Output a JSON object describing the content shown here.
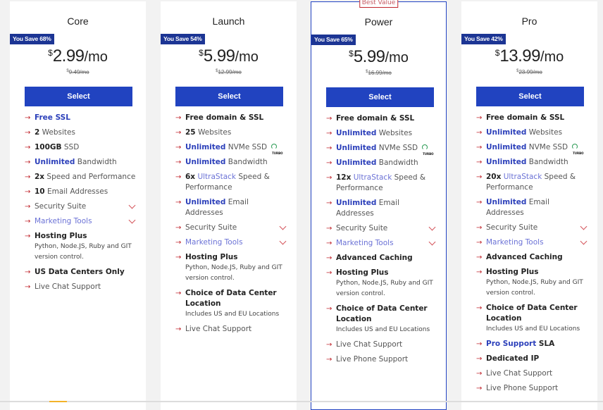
{
  "plans": [
    {
      "name": "Core",
      "save": "You Save 68%",
      "currency": "$",
      "price": "2.99",
      "per": "/mo",
      "old_currency": "$",
      "old_price": "9.49/mo",
      "select": "Select",
      "features": [
        {
          "parts": [
            {
              "t": "Free SSL",
              "s": "blue"
            }
          ]
        },
        {
          "parts": [
            {
              "t": "2",
              "s": "bold"
            },
            {
              "t": " Websites"
            }
          ]
        },
        {
          "parts": [
            {
              "t": "100GB",
              "s": "bold"
            },
            {
              "t": " SSD"
            }
          ]
        },
        {
          "parts": [
            {
              "t": "Unlimited",
              "s": "blue"
            },
            {
              "t": " Bandwidth"
            }
          ]
        },
        {
          "parts": [
            {
              "t": "2x",
              "s": "bold"
            },
            {
              "t": " Speed and Performance"
            }
          ]
        },
        {
          "parts": [
            {
              "t": "10",
              "s": "bold"
            },
            {
              "t": " Email Addresses"
            }
          ]
        },
        {
          "parts": [
            {
              "t": "Security Suite"
            }
          ],
          "toggle": true
        },
        {
          "parts": [
            {
              "t": "Marketing Tools",
              "s": "light-blue"
            }
          ],
          "toggle": true
        },
        {
          "parts": [
            {
              "t": "Hosting Plus",
              "s": "bold"
            }
          ],
          "sub": "Python,  Node.JS,  Ruby and GIT version control."
        },
        {
          "parts": [
            {
              "t": "US Data Centers Only",
              "s": "bold"
            }
          ]
        },
        {
          "parts": [
            {
              "t": "Live Chat Support"
            }
          ]
        }
      ]
    },
    {
      "name": "Launch",
      "save": "You Save 54%",
      "currency": "$",
      "price": "5.99",
      "per": "/mo",
      "old_currency": "$",
      "old_price": "12.99/mo",
      "select": "Select",
      "features": [
        {
          "parts": [
            {
              "t": "Free domain & SSL",
              "s": "bold"
            }
          ]
        },
        {
          "parts": [
            {
              "t": "25",
              "s": "bold"
            },
            {
              "t": " Websites"
            }
          ]
        },
        {
          "parts": [
            {
              "t": "Unlimited",
              "s": "blue"
            },
            {
              "t": " NVMe SSD"
            }
          ],
          "turbo": true
        },
        {
          "parts": [
            {
              "t": "Unlimited",
              "s": "blue"
            },
            {
              "t": " Bandwidth"
            }
          ]
        },
        {
          "parts": [
            {
              "t": "6x",
              "s": "bold"
            },
            {
              "t": " "
            },
            {
              "t": "UltraStack",
              "s": "light-blue"
            },
            {
              "t": " Speed & Performance"
            }
          ]
        },
        {
          "parts": [
            {
              "t": "Unlimited",
              "s": "blue"
            },
            {
              "t": " Email Addresses"
            }
          ]
        },
        {
          "parts": [
            {
              "t": "Security Suite"
            }
          ],
          "toggle": true
        },
        {
          "parts": [
            {
              "t": "Marketing Tools",
              "s": "light-blue"
            }
          ],
          "toggle": true
        },
        {
          "parts": [
            {
              "t": "Hosting Plus",
              "s": "bold"
            }
          ],
          "sub": "Python,  Node.JS,  Ruby and GIT version control."
        },
        {
          "parts": [
            {
              "t": "Choice of Data Center Location",
              "s": "bold"
            }
          ],
          "sub": "Includes US and EU Locations"
        },
        {
          "parts": [
            {
              "t": "Live Chat Support"
            }
          ]
        }
      ]
    },
    {
      "name": "Power",
      "save": "You Save 65%",
      "currency": "$",
      "price": "5.99",
      "per": "/mo",
      "old_currency": "$",
      "old_price": "16.99/mo",
      "select": "Select",
      "tag": "Best Value",
      "features": [
        {
          "parts": [
            {
              "t": "Free domain & SSL",
              "s": "bold"
            }
          ]
        },
        {
          "parts": [
            {
              "t": "Unlimited",
              "s": "blue"
            },
            {
              "t": " Websites"
            }
          ]
        },
        {
          "parts": [
            {
              "t": "Unlimited",
              "s": "blue"
            },
            {
              "t": " NVMe SSD"
            }
          ],
          "turbo": true
        },
        {
          "parts": [
            {
              "t": "Unlimited",
              "s": "blue"
            },
            {
              "t": " Bandwidth"
            }
          ]
        },
        {
          "parts": [
            {
              "t": "12x",
              "s": "bold"
            },
            {
              "t": " "
            },
            {
              "t": "UltraStack",
              "s": "light-blue"
            },
            {
              "t": " Speed & Performance"
            }
          ]
        },
        {
          "parts": [
            {
              "t": "Unlimited",
              "s": "blue"
            },
            {
              "t": " Email Addresses"
            }
          ]
        },
        {
          "parts": [
            {
              "t": "Security Suite"
            }
          ],
          "toggle": true
        },
        {
          "parts": [
            {
              "t": "Marketing Tools",
              "s": "light-blue"
            }
          ],
          "toggle": true
        },
        {
          "parts": [
            {
              "t": "Advanced Caching",
              "s": "bold"
            }
          ]
        },
        {
          "parts": [
            {
              "t": "Hosting Plus",
              "s": "bold"
            }
          ],
          "sub": "Python,  Node.JS,  Ruby and GIT version control."
        },
        {
          "parts": [
            {
              "t": "Choice of Data Center Location",
              "s": "bold"
            }
          ],
          "sub": "Includes US and EU Locations"
        },
        {
          "parts": [
            {
              "t": "Live Chat Support"
            }
          ]
        },
        {
          "parts": [
            {
              "t": "Live Phone Support"
            }
          ]
        }
      ]
    },
    {
      "name": "Pro",
      "save": "You Save 42%",
      "currency": "$",
      "price": "13.99",
      "per": "/mo",
      "old_currency": "$",
      "old_price": "23.99/mo",
      "select": "Select",
      "features": [
        {
          "parts": [
            {
              "t": "Free domain & SSL",
              "s": "bold"
            }
          ]
        },
        {
          "parts": [
            {
              "t": "Unlimited",
              "s": "blue"
            },
            {
              "t": " Websites"
            }
          ]
        },
        {
          "parts": [
            {
              "t": "Unlimited",
              "s": "blue"
            },
            {
              "t": " NVMe SSD"
            }
          ],
          "turbo": true
        },
        {
          "parts": [
            {
              "t": "Unlimited",
              "s": "blue"
            },
            {
              "t": " Bandwidth"
            }
          ]
        },
        {
          "parts": [
            {
              "t": "20x",
              "s": "bold"
            },
            {
              "t": " "
            },
            {
              "t": "UltraStack",
              "s": "light-blue"
            },
            {
              "t": " Speed & Performance"
            }
          ]
        },
        {
          "parts": [
            {
              "t": "Unlimited",
              "s": "blue"
            },
            {
              "t": " Email Addresses"
            }
          ]
        },
        {
          "parts": [
            {
              "t": "Security Suite"
            }
          ],
          "toggle": true
        },
        {
          "parts": [
            {
              "t": "Marketing Tools",
              "s": "light-blue"
            }
          ],
          "toggle": true
        },
        {
          "parts": [
            {
              "t": "Advanced Caching",
              "s": "bold"
            }
          ]
        },
        {
          "parts": [
            {
              "t": "Hosting Plus",
              "s": "bold"
            }
          ],
          "sub": "Python,  Node.JS,  Ruby and GIT version control."
        },
        {
          "parts": [
            {
              "t": "Choice of Data Center Location",
              "s": "bold"
            }
          ],
          "sub": "Includes US and EU Locations"
        },
        {
          "parts": [
            {
              "t": "Pro Support",
              "s": "blue"
            },
            {
              "t": " SLA",
              "s": "bold"
            }
          ]
        },
        {
          "parts": [
            {
              "t": "Dedicated IP",
              "s": "bold"
            }
          ]
        },
        {
          "parts": [
            {
              "t": "Live Chat Support"
            }
          ]
        },
        {
          "parts": [
            {
              "t": "Live Phone Support"
            }
          ]
        }
      ]
    }
  ],
  "icons": {
    "arrow": "→",
    "turbo_label": "TURBO"
  },
  "colors": {
    "brand_blue": "#2143c0",
    "badge_blue": "#1c3594",
    "arrow_red": "#c0262d"
  }
}
